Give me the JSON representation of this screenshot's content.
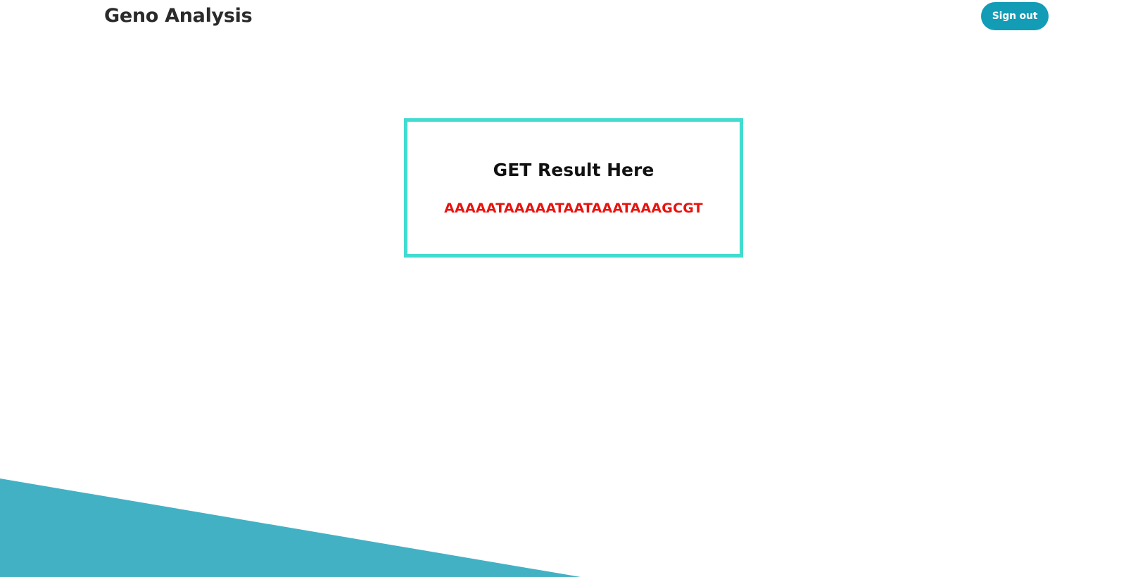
{
  "header": {
    "brand": "Geno Analysis",
    "sign_out_label": "Sign out"
  },
  "result": {
    "heading": "GET Result Here",
    "sequence": "AAAAATAAAAATAATAAATAAAGCGT"
  },
  "colors": {
    "accent": "#129cb5",
    "box_border": "#41dccf",
    "sequence_text": "#e8130e",
    "decor_shape": "#43b1c4"
  }
}
